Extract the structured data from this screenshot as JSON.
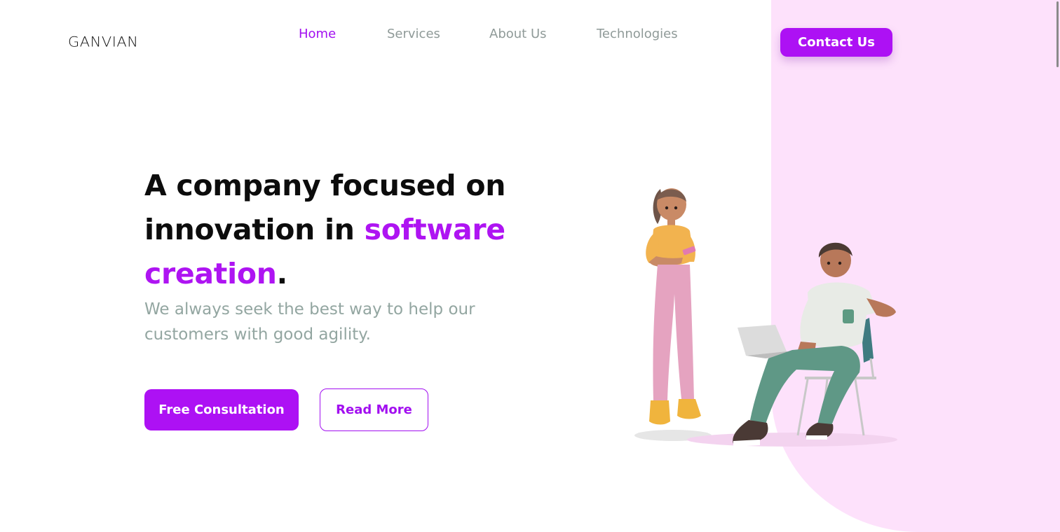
{
  "header": {
    "logo": "GANVIAN",
    "nav": [
      {
        "label": "Home",
        "active": true
      },
      {
        "label": "Services",
        "active": false
      },
      {
        "label": "About Us",
        "active": false
      },
      {
        "label": "Technologies",
        "active": false
      }
    ],
    "contact_label": "Contact Us"
  },
  "hero": {
    "title_part1": "A company focused on innovation in ",
    "title_accent": "software creation",
    "title_end": ".",
    "subtitle": "We always seek the best way to help our customers with good agility.",
    "primary_button": "Free Consultation",
    "secondary_button": "Read More"
  },
  "colors": {
    "accent": "#ad11f4",
    "muted_text": "#93a6a1",
    "pink_bg": "#fde1fb"
  }
}
